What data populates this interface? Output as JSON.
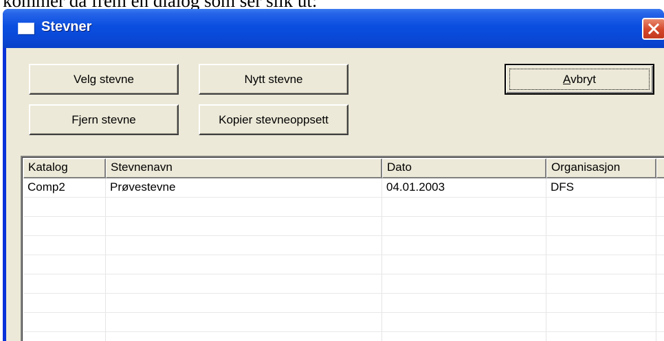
{
  "document": {
    "text": "kommer da frem en dialog som ser slik ut:"
  },
  "window": {
    "title": "Stevner",
    "icon": "window-icon",
    "close_icon": "close-icon",
    "colors": {
      "titlebar": "#0a4ee0",
      "close": "#d3462a",
      "face": "#ece9d8"
    }
  },
  "buttons": {
    "select": "Velg stevne",
    "new": "Nytt stevne",
    "cancel": "Avbryt",
    "cancel_mnemonic": "A",
    "cancel_rest": "vbryt",
    "remove": "Fjern stevne",
    "copy": "Kopier stevneoppsett"
  },
  "table": {
    "columns": [
      "Katalog",
      "Stevnenavn",
      "Dato",
      "Organisasjon"
    ],
    "rows": [
      [
        "Comp2",
        "Prøvestevne",
        "04.01.2003",
        "DFS"
      ]
    ]
  }
}
